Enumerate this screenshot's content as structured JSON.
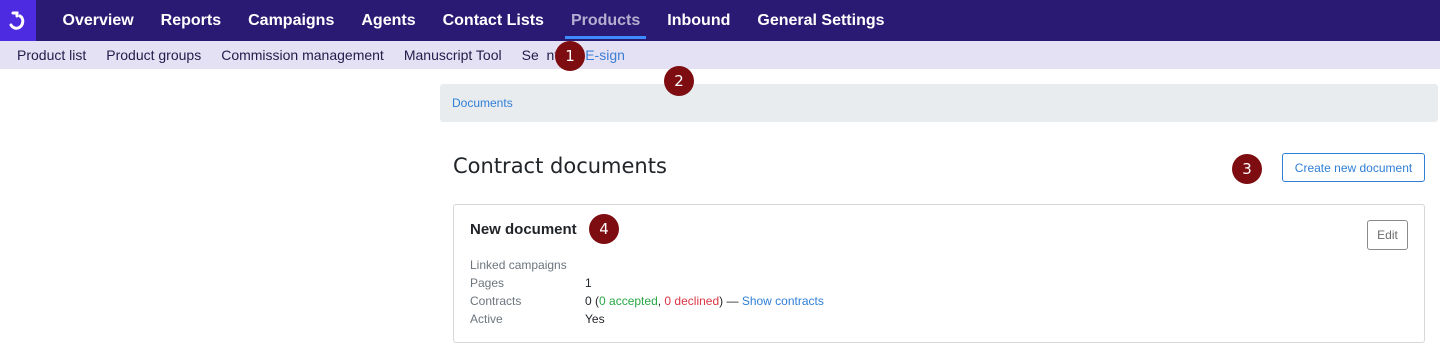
{
  "topnav": {
    "items": [
      {
        "label": "Overview"
      },
      {
        "label": "Reports"
      },
      {
        "label": "Campaigns"
      },
      {
        "label": "Agents"
      },
      {
        "label": "Contact Lists"
      },
      {
        "label": "Products"
      },
      {
        "label": "Inbound"
      },
      {
        "label": "General Settings"
      }
    ],
    "active": "Products"
  },
  "subnav": {
    "items": [
      {
        "label": "Product list"
      },
      {
        "label": "Product groups"
      },
      {
        "label": "Commission management"
      },
      {
        "label": "Manuscript Tool"
      },
      {
        "label": "Se  nts"
      },
      {
        "label": "E-sign"
      }
    ],
    "active": "E-sign"
  },
  "breadcrumb": {
    "label": "Documents"
  },
  "page": {
    "title": "Contract documents",
    "create_button": "Create new document"
  },
  "document": {
    "title": "New document",
    "edit_button": "Edit",
    "fields": {
      "linked_campaigns_label": "Linked campaigns",
      "pages_label": "Pages",
      "pages_value": "1",
      "contracts_label": "Contracts",
      "contracts_count": "0",
      "contracts_open": "(",
      "accepted": "0 accepted",
      "comma": ", ",
      "declined": "0 declined",
      "contracts_close": ") — ",
      "show_contracts": "Show contracts",
      "active_label": "Active",
      "active_value": "Yes"
    }
  },
  "markers": [
    "1",
    "2",
    "3",
    "4"
  ],
  "colors": {
    "topnav_bg": "#2b1a73",
    "logo_bg": "#4d2be0",
    "subnav_bg": "#e4e1f4",
    "link": "#2f7fd6",
    "marker": "#7d0d10",
    "accepted": "#28a745",
    "declined": "#dc3545"
  }
}
